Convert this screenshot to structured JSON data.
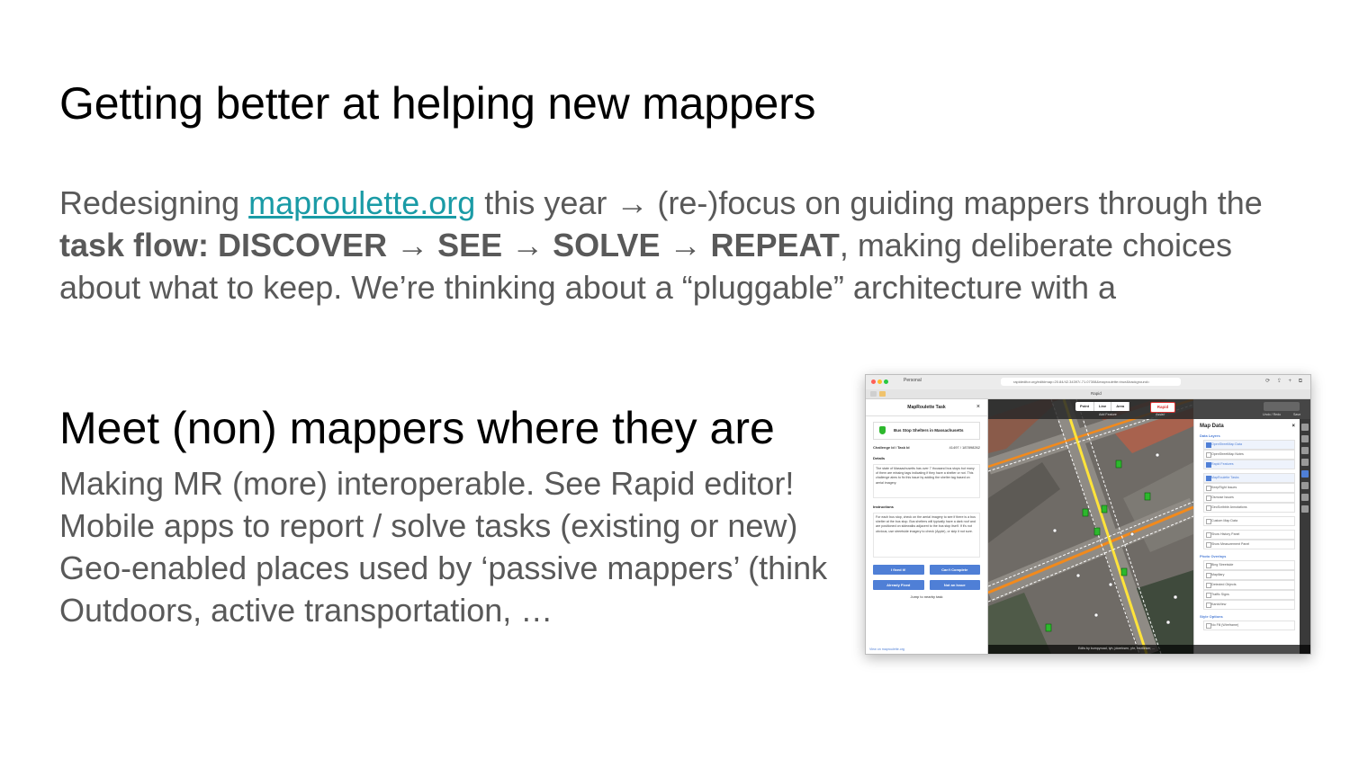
{
  "slide": {
    "title": "Getting better at helping new mappers",
    "para": {
      "pre": "Redesigning ",
      "link": "maproulette.org",
      "mid1": " this year → (re-)focus on guiding mappers through the ",
      "flow": "task flow: DISCOVER → SEE → SOLVE → REPEAT",
      "post": ", making deliberate choices about what to keep. We’re thinking about a “pluggable” architecture with a"
    },
    "section_title": "Meet (non) mappers where they are",
    "bullets": [
      "Making MR (more) interoperable. See Rapid editor!",
      "Mobile apps to report / solve tasks (existing or new)",
      "Geo-enabled places used by ‘passive mappers’ (think",
      "Outdoors, active transportation, …"
    ]
  },
  "screenshot": {
    "browser": {
      "profile": "Personal",
      "url": "rapideditor.org/edit#map=20.84/42.34397/-71.07308&maproulette=true&background=",
      "tab_title": "Rapid"
    },
    "task_panel": {
      "header": "MapRoulette Task",
      "close": "×",
      "challenge_name": "Bus Stop Shelters in Massachusetts",
      "challenge_label": "Challenge Id / Task Id",
      "challenge_ids": "41497 / 187898262",
      "details_label": "Details",
      "details_text": "The state of Massachusetts has over 7 thousand bus stops but many of them are missing tags indicating if they have a shelter or not. This challenge aims to fix this issue by adding the shelter tag based on aerial imagery.",
      "instructions_label": "Instructions",
      "instructions_text": "For each bus stop, check on the aerial imagery to see if there is a bus shelter at the bus stop. Bus shelters will typically have a dark roof and are positioned on sidewalks adjacent to the bus stop itself. If it's not obvious, use streetside imagery to check (Apple), or skip it not sure.",
      "buttons": [
        "I fixed it!",
        "Can't Complete",
        "Already Fixed",
        "Not an Issue"
      ],
      "jump_label": "Jump to nearby task",
      "footer_link": "View on maproulette.org"
    },
    "toolbar": {
      "buttons": [
        "Point",
        "Line",
        "Area"
      ],
      "rapid_label": "Rapid",
      "add_feature": "Add Feature",
      "assist": "Assist",
      "undo_redo": "Undo / Redo",
      "save": "Save"
    },
    "map_data": {
      "title": "Map Data",
      "close": "×",
      "sections": [
        {
          "name": "Data Layers",
          "items": [
            {
              "label": "OpenStreetMap Data",
              "on": true
            },
            {
              "label": "OpenStreetMap Notes",
              "on": false
            },
            {
              "label": "Rapid Features",
              "on": true
            }
          ]
        },
        {
          "name": "",
          "items": [
            {
              "label": "MapRoulette Tasks",
              "on": true
            },
            {
              "label": "KeepRight Issues",
              "on": false
            },
            {
              "label": "Osmose Issues",
              "on": false
            },
            {
              "label": "GeoScribble Annotations",
              "on": false
            }
          ]
        },
        {
          "name": "",
          "items": [
            {
              "label": "Custom Map Data",
              "on": false
            }
          ]
        },
        {
          "name": "",
          "items": [
            {
              "label": "Show History Panel",
              "on": false
            },
            {
              "label": "Show Measurement Panel",
              "on": false
            }
          ]
        },
        {
          "name": "Photo Overlays",
          "items": [
            {
              "label": "Bing Streetside",
              "on": false
            },
            {
              "label": "Mapillary",
              "on": false
            },
            {
              "label": "Detected Objects",
              "on": false
            },
            {
              "label": "Traffic Signs",
              "on": false
            },
            {
              "label": "KartaView",
              "on": false
            }
          ]
        },
        {
          "name": "Style Options",
          "items": [
            {
              "label": "No Fill (Wireframe)",
              "on": false
            }
          ]
        }
      ],
      "challenge_ids_placeholder": "Challenge IDs"
    },
    "map_footer": "Edits by bumpyroad, tyh, jdoerksen, yhr, msrtlinker, ..."
  }
}
